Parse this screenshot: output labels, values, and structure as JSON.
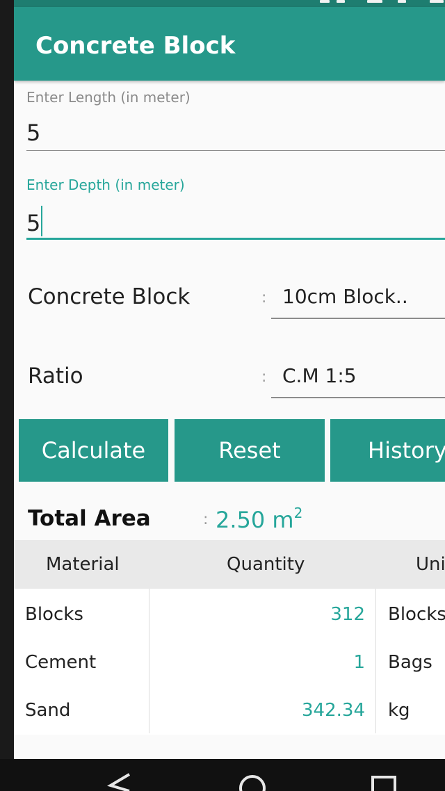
{
  "app_bar": {
    "title": "Concrete Block"
  },
  "length_field": {
    "label": "Enter Length (in meter)",
    "value": "5"
  },
  "depth_field": {
    "label": "Enter Depth (in meter)",
    "value": "5"
  },
  "block_select": {
    "label": "Concrete Block",
    "colon": ":",
    "value": "10cm Block.."
  },
  "ratio_select": {
    "label": "Ratio",
    "colon": ":",
    "value": "C.M 1:5"
  },
  "buttons": {
    "calculate": "Calculate",
    "reset": "Reset",
    "history": "History"
  },
  "total_area": {
    "label": "Total Area",
    "colon": ":",
    "value": "2.50 m",
    "unit_exponent": "2"
  },
  "table": {
    "headers": {
      "material": "Material",
      "quantity": "Quantity",
      "unit": "Uni"
    },
    "rows": [
      {
        "material": "Blocks",
        "quantity": "312",
        "unit": "Blocks"
      },
      {
        "material": "Cement",
        "quantity": "1",
        "unit": "Bags"
      },
      {
        "material": "Sand",
        "quantity": "342.34",
        "unit": "kg"
      }
    ]
  },
  "icons": {
    "nav_back": "triangle-back-icon",
    "nav_home": "circle-home-icon",
    "nav_recents": "square-recents-icon"
  },
  "colors": {
    "primary": "#26988a",
    "accent": "#26a69a",
    "status_bar": "#1e7d70"
  }
}
